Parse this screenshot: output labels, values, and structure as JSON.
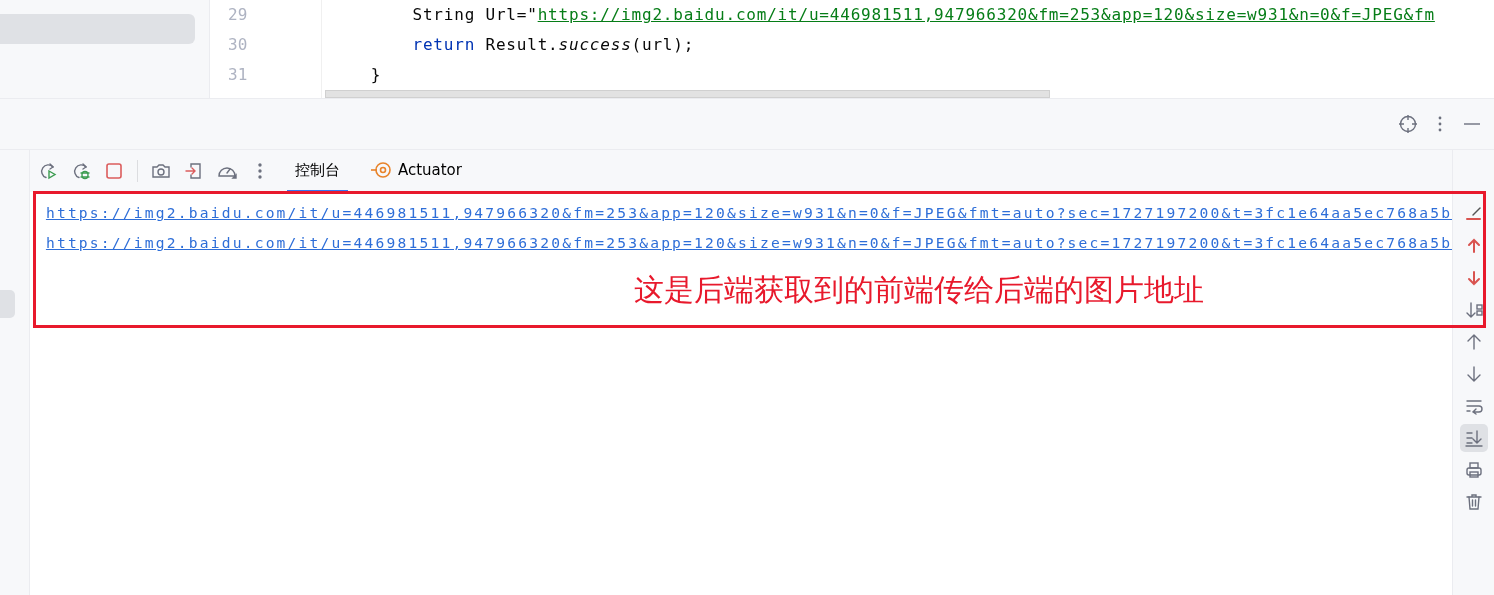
{
  "editor": {
    "lines": [
      {
        "number": "29",
        "code": [
          {
            "kind": "plain",
            "text": "        String Url=\""
          },
          {
            "kind": "string",
            "text": "https://img2.baidu.com/it/u=446981511,947966320&fm=253&app=120&size=w931&n=0&f=JPEG&fm"
          }
        ]
      },
      {
        "number": "30",
        "code": [
          {
            "kind": "keyword",
            "text": "        return"
          },
          {
            "kind": "plain",
            "text": " Result."
          },
          {
            "kind": "italic",
            "text": "success"
          },
          {
            "kind": "plain",
            "text": "(url);"
          }
        ]
      },
      {
        "number": "31",
        "code": [
          {
            "kind": "plain",
            "text": "    }"
          }
        ]
      }
    ]
  },
  "run_panel": {
    "tabs": [
      {
        "label": "控制台",
        "kind": "text",
        "selected": true
      },
      {
        "label": "Actuator",
        "kind": "actuator",
        "selected": false
      }
    ],
    "console": {
      "lines": [
        {
          "text": "https://img2.baidu.com/it/u=446981511,947966320&fm=253&app=120&size=w931&n=0&f=JPEG&fmt=auto?sec=1727197200&t=3fc1e64aa5ec768a5b"
        },
        {
          "text": "https://img2.baidu.com/it/u=446981511,947966320&fm=253&app=120&size=w931&n=0&f=JPEG&fmt=auto?sec=1727197200&t=3fc1e64aa5ec768a5b"
        }
      ]
    },
    "side_toolbar": [
      {
        "kind": "clear",
        "selected": false
      },
      {
        "kind": "prev-error",
        "selected": false
      },
      {
        "kind": "next-error",
        "selected": false
      },
      {
        "kind": "sort",
        "selected": false
      },
      {
        "kind": "up",
        "selected": false
      },
      {
        "kind": "down",
        "selected": false
      },
      {
        "kind": "wrap",
        "selected": false
      },
      {
        "kind": "scroll-end",
        "selected": true
      },
      {
        "kind": "print",
        "selected": false
      },
      {
        "kind": "trash",
        "selected": false
      }
    ]
  },
  "annotation": {
    "text": "这是后端获取到的前端传给后端的图片地址"
  }
}
